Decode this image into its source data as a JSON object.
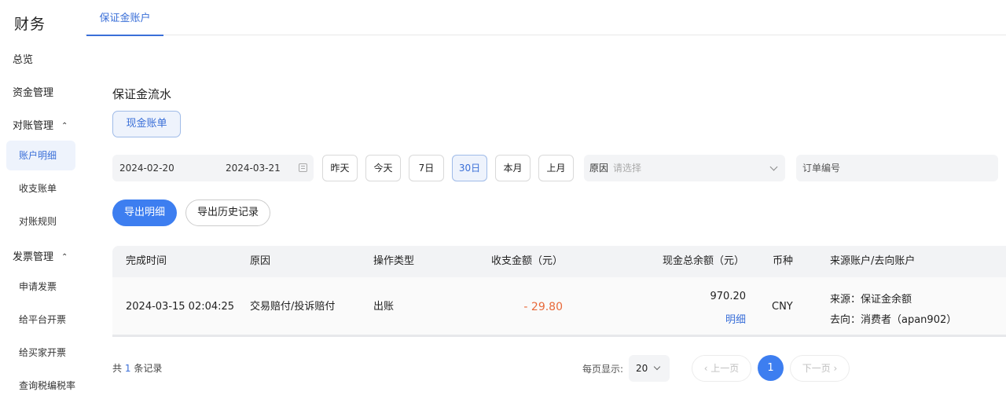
{
  "sidebar": {
    "title": "财务",
    "items": [
      {
        "label": "总览"
      },
      {
        "label": "资金管理"
      },
      {
        "label": "对账管理"
      },
      {
        "label": "账户明细"
      },
      {
        "label": "收支账单"
      },
      {
        "label": "对账规则"
      },
      {
        "label": "发票管理"
      },
      {
        "label": "申请发票"
      },
      {
        "label": "给平台开票"
      },
      {
        "label": "给买家开票"
      },
      {
        "label": "查询税编税率"
      }
    ],
    "expand_icon": "chevron-up-icon"
  },
  "tabs": [
    {
      "label": "保证金账户"
    }
  ],
  "section_title": "保证金流水",
  "account_type_button": "现金账单",
  "filters": {
    "start_date": "2024-02-20",
    "end_date": "2024-03-21",
    "quick_ranges": [
      "昨天",
      "今天",
      "7日",
      "30日",
      "本月",
      "上月"
    ],
    "selected_range": "30日",
    "reason_label": "原因",
    "reason_placeholder": "请选择",
    "order_placeholder": "订单编号"
  },
  "actions": {
    "export_detail": "导出明细",
    "export_history": "导出历史记录"
  },
  "table": {
    "columns": [
      "完成时间",
      "原因",
      "操作类型",
      "收支金额（元）",
      "现金总余额（元）",
      "币种",
      "来源账户/去向账户"
    ],
    "rows": [
      {
        "time": "2024-03-15 02:04:25",
        "reason": "交易赔付/投诉赔付",
        "op_type": "出账",
        "amount": "- 29.80",
        "balance": "970.20",
        "balance_link": "明细",
        "currency": "CNY",
        "source": "来源：保证金余额",
        "target": "去向：消费者（apan902）"
      }
    ]
  },
  "pagination": {
    "total_prefix": "共",
    "total_count": "1",
    "total_suffix": "条记录",
    "page_size_label": "每页显示:",
    "page_size": "20",
    "prev": "‹ 上一页",
    "current_page": "1",
    "next": "下一页 ›"
  },
  "colors": {
    "primary": "#3d7ef0",
    "negative": "#e8693a",
    "link": "#3a6fd8"
  }
}
